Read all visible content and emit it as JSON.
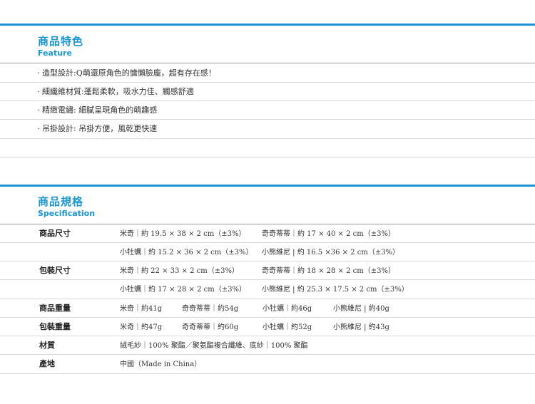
{
  "feature": {
    "title_zh": "商品特色",
    "title_en": "Feature",
    "items": [
      "造型設計:Q萌還原角色的慵懶臉龐，超有存在感！",
      "細纖維材質:蓬鬆柔軟，吸水力佳、觸感舒適",
      "精緻電繡: 細膩呈現角色的萌趣感",
      "吊掛設計: 吊掛方便，風乾更快速"
    ]
  },
  "spec": {
    "title_zh": "商品規格",
    "title_en": "Specification",
    "rows": [
      {
        "label": "商品尺寸",
        "cells": [
          "米奇｜約 19.5 × 38 × 2 cm（±3%）",
          "奇奇蒂蒂｜約 17 × 40 × 2 cm（±3%）"
        ]
      },
      {
        "label": "",
        "cells": [
          "小牡蠣｜約 15.2 × 36 × 2 cm（±3%）",
          "小熊維尼 | 約 16.5 ×36 × 2 cm（±3%）"
        ]
      },
      {
        "label": "包裝尺寸",
        "cells": [
          "米奇｜約 22 × 33 × 2 cm（±3%）",
          "奇奇蒂蒂｜約 18 × 28 × 2 cm（±3%）"
        ]
      },
      {
        "label": "",
        "cells": [
          "小牡蠣｜約 17 × 28 × 2 cm（±3%）",
          "小熊維尼 | 約 25.3 × 17.5 × 2 cm（±3%）"
        ]
      },
      {
        "label": "商品重量",
        "cells": [
          "米奇｜約41g",
          "奇奇蒂蒂｜約54g",
          "小牡蠣｜約46g",
          "小熊維尼 | 約40g"
        ]
      },
      {
        "label": "包裝重量",
        "cells": [
          "米奇｜約47g",
          "奇奇蒂蒂｜約60g",
          "小牡蠣｜約52g",
          "小熊維尼 | 約43g"
        ]
      },
      {
        "label": "材質",
        "cells": [
          "絨毛紗｜100% 聚酯／聚氨酯複合纖維、底紗｜100% 聚酯"
        ]
      },
      {
        "label": "產地",
        "cells": [
          "中國（Made in China）"
        ]
      }
    ]
  },
  "colors": {
    "accent": "#1a96d4",
    "divider": "#d9d9d9"
  }
}
